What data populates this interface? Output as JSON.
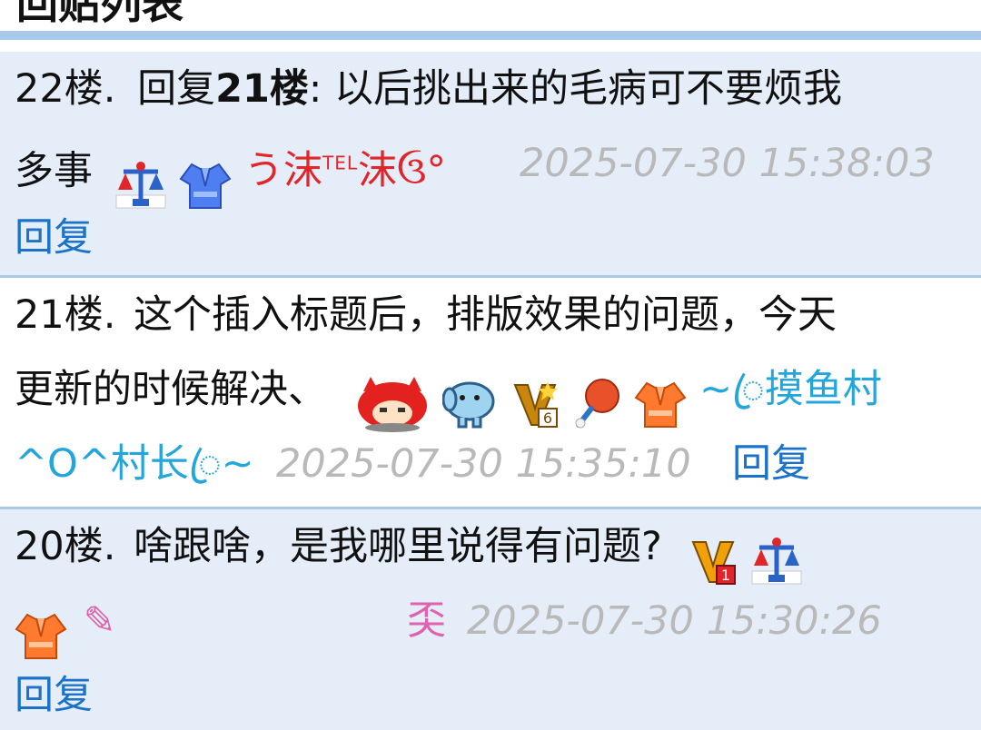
{
  "header": {
    "title": "回贴列表"
  },
  "posts": [
    {
      "floor": "22楼.",
      "reply_prefix": "回复",
      "reply_target": "21楼",
      "content_line1": ": 以后挑出来的毛病可不要烦我",
      "content_line2": "多事",
      "nick_part1": "う沫",
      "nick_tel": "TEL",
      "nick_part2": "沫",
      "nick_tail": "ઉ°",
      "timestamp": "2025-07-30 15:38:03",
      "reply_label": "回复",
      "badge_icons": [
        "scale-icon",
        "robe-blue-icon"
      ]
    },
    {
      "floor": "21楼.",
      "content_line1": "这个插入标题后，排版效果的问题，今天",
      "content_line2": "更新的时候解决、",
      "nick_line1": "~ꦿ摸鱼村",
      "nick_line2": "^O^村长ꦿ~",
      "timestamp": "2025-07-30 15:35:10",
      "reply_label": "回复",
      "badge_icons": [
        "red-cat-avatar-icon",
        "blue-elephant-icon",
        "vip-6-badge-icon",
        "ping-pong-icon",
        "robe-orange-icon"
      ]
    },
    {
      "floor": "20楼.",
      "content_line1": "啥跟啥，是我哪里说得有问题?",
      "nick": "奀",
      "pencil": "✎",
      "timestamp": "2025-07-30 15:30:26",
      "reply_label": "回复",
      "badge_icons": [
        "vip-1-badge-icon",
        "scale-icon",
        "robe-orange-icon"
      ]
    }
  ],
  "colors": {
    "accent_bar": "#a9c9ea",
    "alt_row": "#e4edf8",
    "link": "#1a73c8",
    "timestamp": "#b9b9b9",
    "nick_red": "#e0262a",
    "nick_cyan": "#23a6dc",
    "nick_pink": "#e062ae"
  }
}
